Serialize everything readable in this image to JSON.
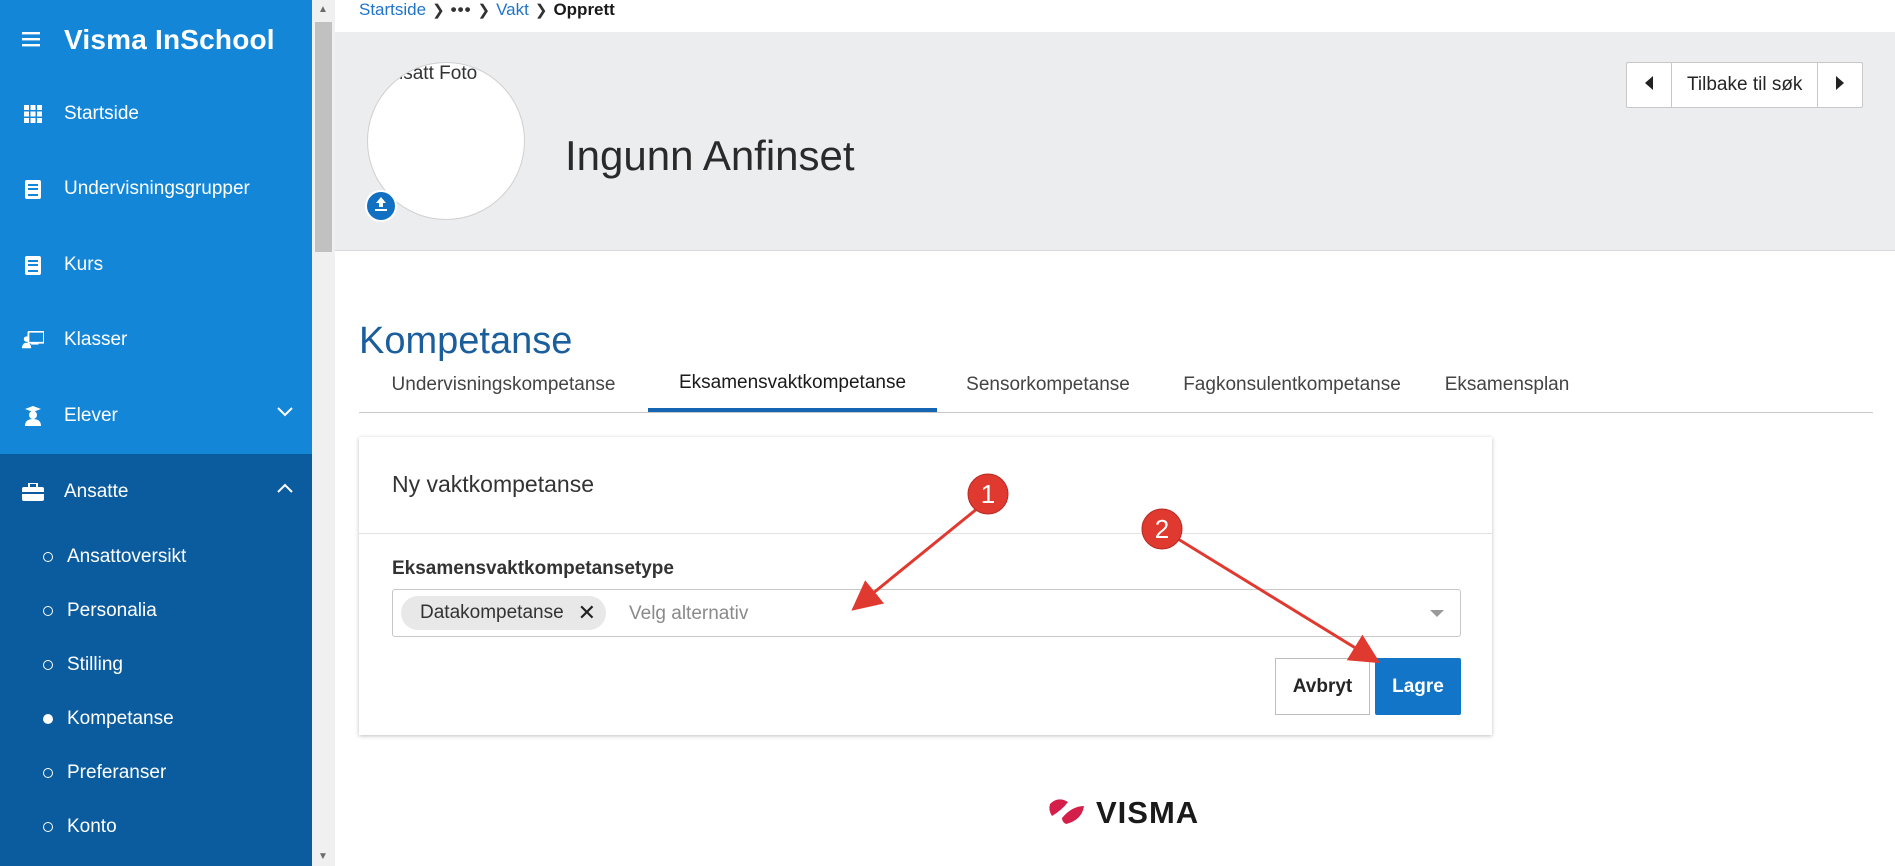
{
  "app": {
    "title": "Visma InSchool"
  },
  "sidebar": {
    "items": [
      {
        "label": "Startside",
        "icon": "grid-icon"
      },
      {
        "label": "Undervisningsgrupper",
        "icon": "book-icon"
      },
      {
        "label": "Kurs",
        "icon": "book-icon"
      },
      {
        "label": "Klasser",
        "icon": "classroom-icon"
      },
      {
        "label": "Elever",
        "icon": "student-icon",
        "expanded": false
      },
      {
        "label": "Ansatte",
        "icon": "briefcase-icon",
        "expanded": true
      }
    ],
    "subitems": [
      {
        "label": "Ansattoversikt",
        "active": false
      },
      {
        "label": "Personalia",
        "active": false
      },
      {
        "label": "Stilling",
        "active": false
      },
      {
        "label": "Kompetanse",
        "active": true
      },
      {
        "label": "Preferanser",
        "active": false
      },
      {
        "label": "Konto",
        "active": false
      }
    ]
  },
  "breadcrumb": {
    "home": "Startside",
    "ellipsis": "•••",
    "parent": "Vakt",
    "current": "Opprett"
  },
  "profile": {
    "photo_alt": "Ansatt Foto",
    "name": "Ingunn Anfinset",
    "back_label": "Tilbake til søk"
  },
  "section": {
    "title": "Kompetanse"
  },
  "tabs": [
    {
      "label": "Undervisningskompetanse",
      "active": false
    },
    {
      "label": "Eksamensvaktkompetanse",
      "active": true
    },
    {
      "label": "Sensorkompetanse",
      "active": false
    },
    {
      "label": "Fagkonsulentkompetanse",
      "active": false
    },
    {
      "label": "Eksamensplan",
      "active": false
    }
  ],
  "form": {
    "title": "Ny vaktkompetanse",
    "field_label": "Eksamensvaktkompetansetype",
    "selected_chip": "Datakompetanse",
    "placeholder": "Velg alternativ",
    "cancel_label": "Avbryt",
    "save_label": "Lagre"
  },
  "footer": {
    "logo_text": "VISMA"
  },
  "annotations": [
    {
      "number": "1"
    },
    {
      "number": "2"
    }
  ],
  "colors": {
    "sidebar": "#0d7fd4",
    "sidebar_dark": "#0b5c9e",
    "primary": "#1275c7",
    "annotation": "#e03a30",
    "logo_red": "#d31f4a"
  }
}
